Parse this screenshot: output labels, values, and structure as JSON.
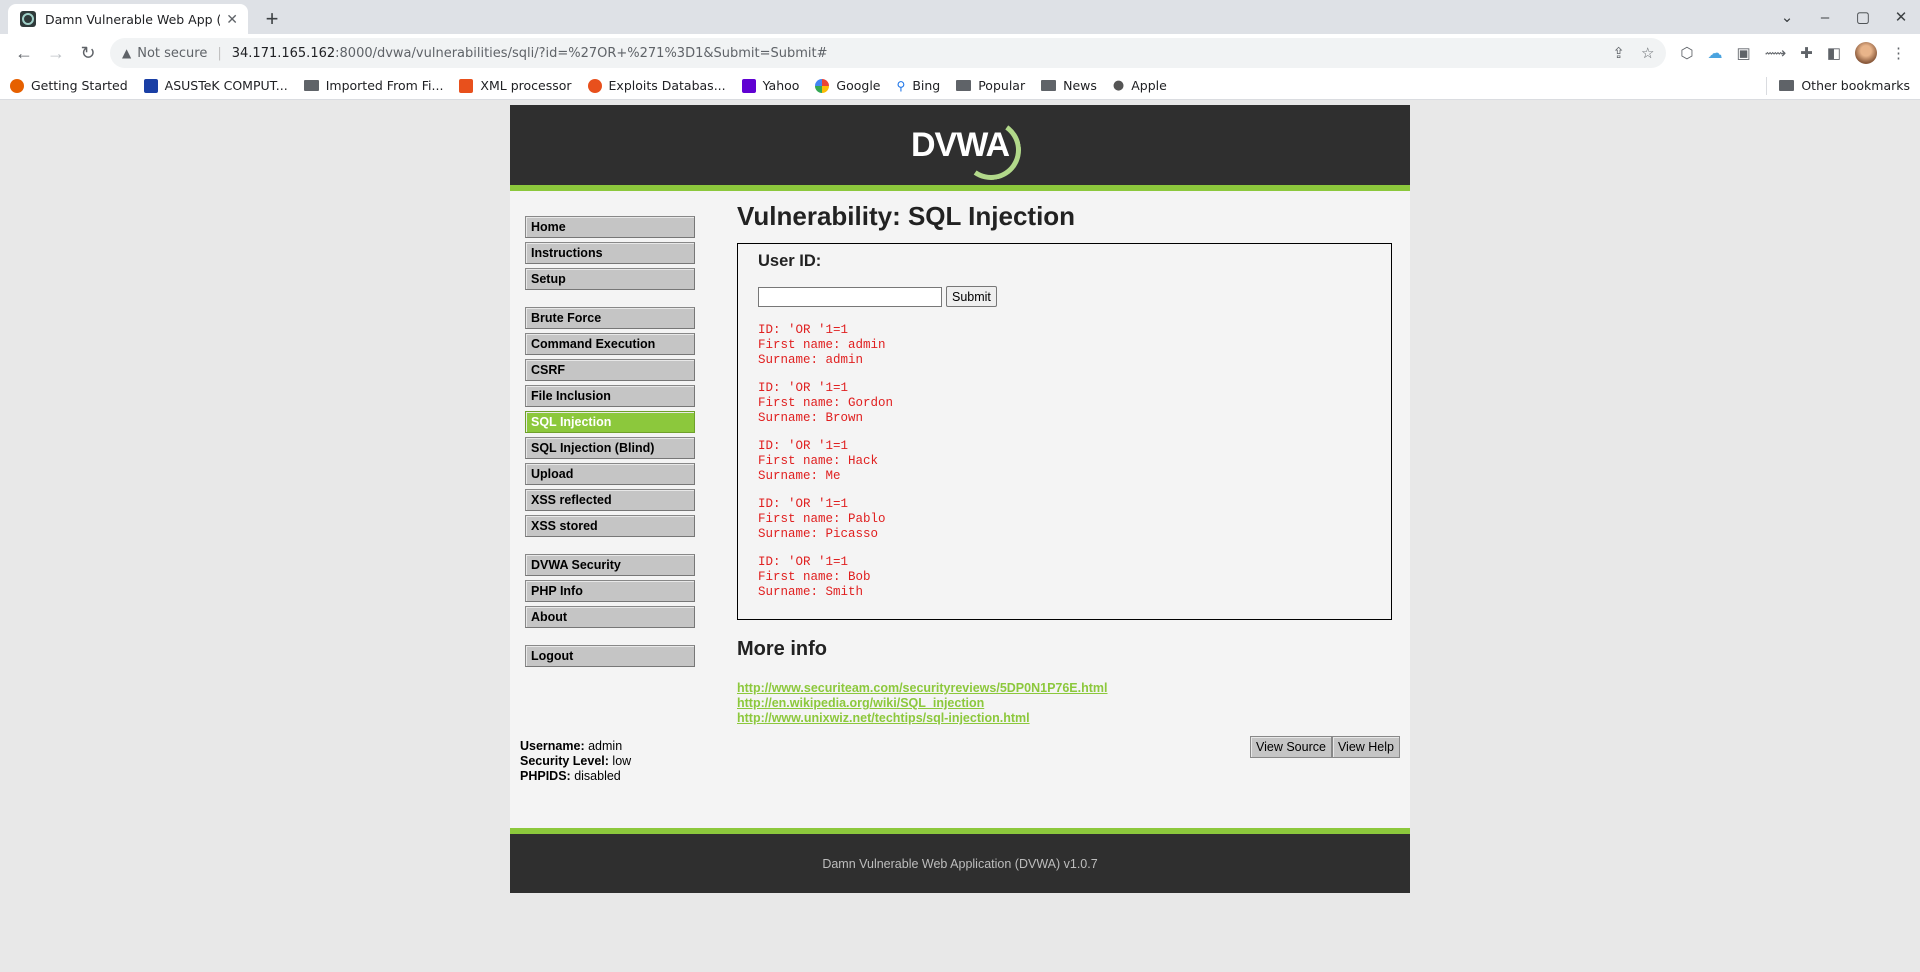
{
  "browser": {
    "tab_title": "Damn Vulnerable Web App (DV",
    "tab_close": "✕",
    "new_tab": "+",
    "security_label": "Not secure",
    "url_host": "34.171.165.162",
    "url_path": ":8000/dvwa/vulnerabilities/sqli/?id=%27OR+%271%3D1&Submit=Submit#",
    "bookmarks": [
      {
        "label": "Getting Started",
        "icon": "firefox-icon",
        "color": "#e66000"
      },
      {
        "label": "ASUSTeK COMPUT...",
        "icon": "asus-icon",
        "color": "#1a3fa5"
      },
      {
        "label": "Imported From Fi...",
        "icon": "folder-icon",
        "color": "#5f6368"
      },
      {
        "label": "XML processor",
        "icon": "z-icon",
        "color": "#e8501c"
      },
      {
        "label": "Exploits Databas...",
        "icon": "exploitdb-icon",
        "color": "#e8501c"
      },
      {
        "label": "Yahoo",
        "icon": "yahoo-icon",
        "color": "#6001d2"
      },
      {
        "label": "Google",
        "icon": "google-icon",
        "color": "#4285f4"
      },
      {
        "label": "Bing",
        "icon": "search-icon",
        "color": "#1a73e8"
      },
      {
        "label": "Popular",
        "icon": "folder-icon",
        "color": "#5f6368"
      },
      {
        "label": "News",
        "icon": "folder-icon",
        "color": "#5f6368"
      },
      {
        "label": "Apple",
        "icon": "apple-icon",
        "color": "#555555"
      }
    ],
    "other_bookmarks": "Other bookmarks"
  },
  "app": {
    "logo": "DVWA",
    "menu": {
      "group1": [
        {
          "label": "Home",
          "selected": false
        },
        {
          "label": "Instructions",
          "selected": false
        },
        {
          "label": "Setup",
          "selected": false
        }
      ],
      "group2": [
        {
          "label": "Brute Force",
          "selected": false
        },
        {
          "label": "Command Execution",
          "selected": false
        },
        {
          "label": "CSRF",
          "selected": false
        },
        {
          "label": "File Inclusion",
          "selected": false
        },
        {
          "label": "SQL Injection",
          "selected": true
        },
        {
          "label": "SQL Injection (Blind)",
          "selected": false
        },
        {
          "label": "Upload",
          "selected": false
        },
        {
          "label": "XSS reflected",
          "selected": false
        },
        {
          "label": "XSS stored",
          "selected": false
        }
      ],
      "group3": [
        {
          "label": "DVWA Security",
          "selected": false
        },
        {
          "label": "PHP Info",
          "selected": false
        },
        {
          "label": "About",
          "selected": false
        }
      ],
      "group4": [
        {
          "label": "Logout",
          "selected": false
        }
      ]
    },
    "page_title": "Vulnerability: SQL Injection",
    "form": {
      "label": "User ID:",
      "input_value": "",
      "submit_label": "Submit"
    },
    "results": [
      {
        "id": "ID: 'OR '1=1",
        "first": "First name: admin",
        "surname": "Surname: admin"
      },
      {
        "id": "ID: 'OR '1=1",
        "first": "First name: Gordon",
        "surname": "Surname: Brown"
      },
      {
        "id": "ID: 'OR '1=1",
        "first": "First name: Hack",
        "surname": "Surname: Me"
      },
      {
        "id": "ID: 'OR '1=1",
        "first": "First name: Pablo",
        "surname": "Surname: Picasso"
      },
      {
        "id": "ID: 'OR '1=1",
        "first": "First name: Bob",
        "surname": "Surname: Smith"
      }
    ],
    "more_info": {
      "heading": "More info",
      "links": [
        "http://www.securiteam.com/securityreviews/5DP0N1P76E.html",
        "http://en.wikipedia.org/wiki/SQL_injection",
        "http://www.unixwiz.net/techtips/sql-injection.html"
      ]
    },
    "status": {
      "username_label": "Username:",
      "username": "admin",
      "security_label": "Security Level:",
      "security": "low",
      "phpids_label": "PHPIDS:",
      "phpids": "disabled"
    },
    "view_source": "View Source",
    "view_help": "View Help",
    "footer": "Damn Vulnerable Web Application (DVWA) v1.0.7",
    "colors": {
      "accent": "#8cc83c",
      "header": "#2f2f2f",
      "result_text": "#e02020"
    }
  }
}
